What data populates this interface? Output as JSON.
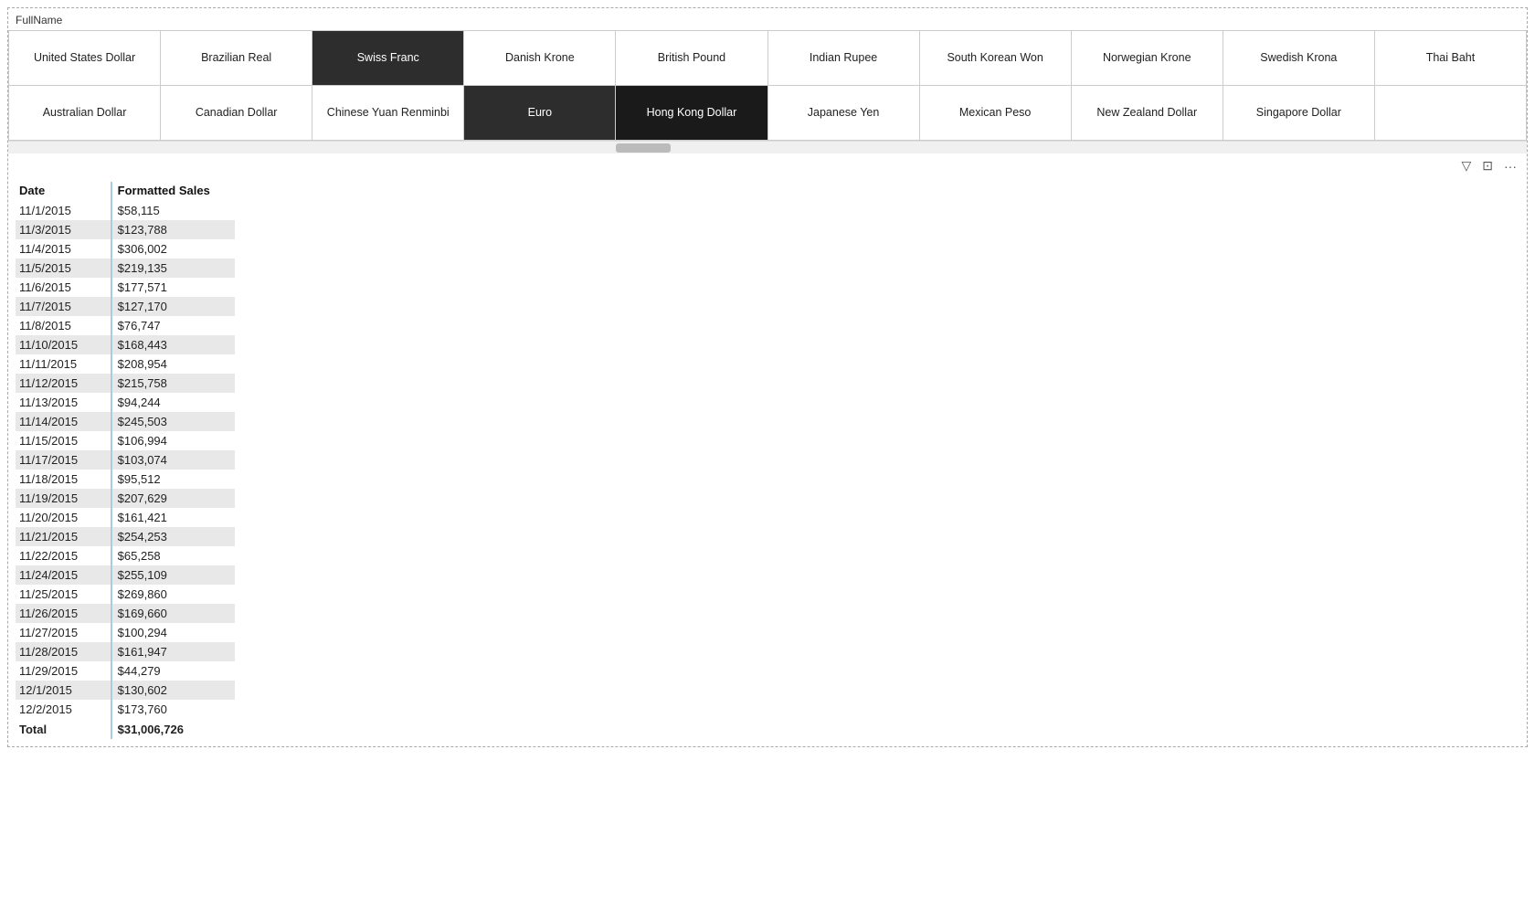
{
  "header": {
    "full_name_label": "FullName"
  },
  "currencies": [
    {
      "label": "United States Dollar",
      "row": 0,
      "col": 0,
      "selected": false
    },
    {
      "label": "Brazilian Real",
      "row": 0,
      "col": 1,
      "selected": false
    },
    {
      "label": "Swiss Franc",
      "row": 0,
      "col": 2,
      "selected": true
    },
    {
      "label": "Danish Krone",
      "row": 0,
      "col": 3,
      "selected": false
    },
    {
      "label": "British Pound",
      "row": 0,
      "col": 4,
      "selected": false
    },
    {
      "label": "Indian Rupee",
      "row": 0,
      "col": 5,
      "selected": false
    },
    {
      "label": "South Korean Won",
      "row": 0,
      "col": 6,
      "selected": false
    },
    {
      "label": "Norwegian Krone",
      "row": 0,
      "col": 7,
      "selected": false
    },
    {
      "label": "Swedish Krona",
      "row": 0,
      "col": 8,
      "selected": false
    },
    {
      "label": "Thai Baht",
      "row": 0,
      "col": 9,
      "selected": false
    },
    {
      "label": "Australian Dollar",
      "row": 1,
      "col": 0,
      "selected": false
    },
    {
      "label": "Canadian Dollar",
      "row": 1,
      "col": 1,
      "selected": false
    },
    {
      "label": "Chinese Yuan Renminbi",
      "row": 1,
      "col": 2,
      "selected": false
    },
    {
      "label": "Euro",
      "row": 1,
      "col": 3,
      "selected": true
    },
    {
      "label": "Hong Kong Dollar",
      "row": 1,
      "col": 4,
      "selected": true
    },
    {
      "label": "Japanese Yen",
      "row": 1,
      "col": 5,
      "selected": false
    },
    {
      "label": "Mexican Peso",
      "row": 1,
      "col": 6,
      "selected": false
    },
    {
      "label": "New Zealand Dollar",
      "row": 1,
      "col": 7,
      "selected": false
    },
    {
      "label": "Singapore Dollar",
      "row": 1,
      "col": 8,
      "selected": false
    }
  ],
  "toolbar": {
    "filter_icon": "▽",
    "export_icon": "⊡",
    "more_icon": "···"
  },
  "table": {
    "col1_header": "Date",
    "col2_header": "Formatted Sales",
    "rows": [
      {
        "date": "11/1/2015",
        "sales": "$58,115",
        "shaded": false
      },
      {
        "date": "11/3/2015",
        "sales": "$123,788",
        "shaded": true
      },
      {
        "date": "11/4/2015",
        "sales": "$306,002",
        "shaded": false
      },
      {
        "date": "11/5/2015",
        "sales": "$219,135",
        "shaded": true
      },
      {
        "date": "11/6/2015",
        "sales": "$177,571",
        "shaded": false
      },
      {
        "date": "11/7/2015",
        "sales": "$127,170",
        "shaded": true
      },
      {
        "date": "11/8/2015",
        "sales": "$76,747",
        "shaded": false
      },
      {
        "date": "11/10/2015",
        "sales": "$168,443",
        "shaded": true
      },
      {
        "date": "11/11/2015",
        "sales": "$208,954",
        "shaded": false
      },
      {
        "date": "11/12/2015",
        "sales": "$215,758",
        "shaded": true
      },
      {
        "date": "11/13/2015",
        "sales": "$94,244",
        "shaded": false
      },
      {
        "date": "11/14/2015",
        "sales": "$245,503",
        "shaded": true
      },
      {
        "date": "11/15/2015",
        "sales": "$106,994",
        "shaded": false
      },
      {
        "date": "11/17/2015",
        "sales": "$103,074",
        "shaded": true
      },
      {
        "date": "11/18/2015",
        "sales": "$95,512",
        "shaded": false
      },
      {
        "date": "11/19/2015",
        "sales": "$207,629",
        "shaded": true
      },
      {
        "date": "11/20/2015",
        "sales": "$161,421",
        "shaded": false
      },
      {
        "date": "11/21/2015",
        "sales": "$254,253",
        "shaded": true
      },
      {
        "date": "11/22/2015",
        "sales": "$65,258",
        "shaded": false
      },
      {
        "date": "11/24/2015",
        "sales": "$255,109",
        "shaded": true
      },
      {
        "date": "11/25/2015",
        "sales": "$269,860",
        "shaded": false
      },
      {
        "date": "11/26/2015",
        "sales": "$169,660",
        "shaded": true
      },
      {
        "date": "11/27/2015",
        "sales": "$100,294",
        "shaded": false
      },
      {
        "date": "11/28/2015",
        "sales": "$161,947",
        "shaded": true
      },
      {
        "date": "11/29/2015",
        "sales": "$44,279",
        "shaded": false
      },
      {
        "date": "12/1/2015",
        "sales": "$130,602",
        "shaded": true
      },
      {
        "date": "12/2/2015",
        "sales": "$173,760",
        "shaded": false
      }
    ],
    "total_label": "Total",
    "total_value": "$31,006,726"
  }
}
